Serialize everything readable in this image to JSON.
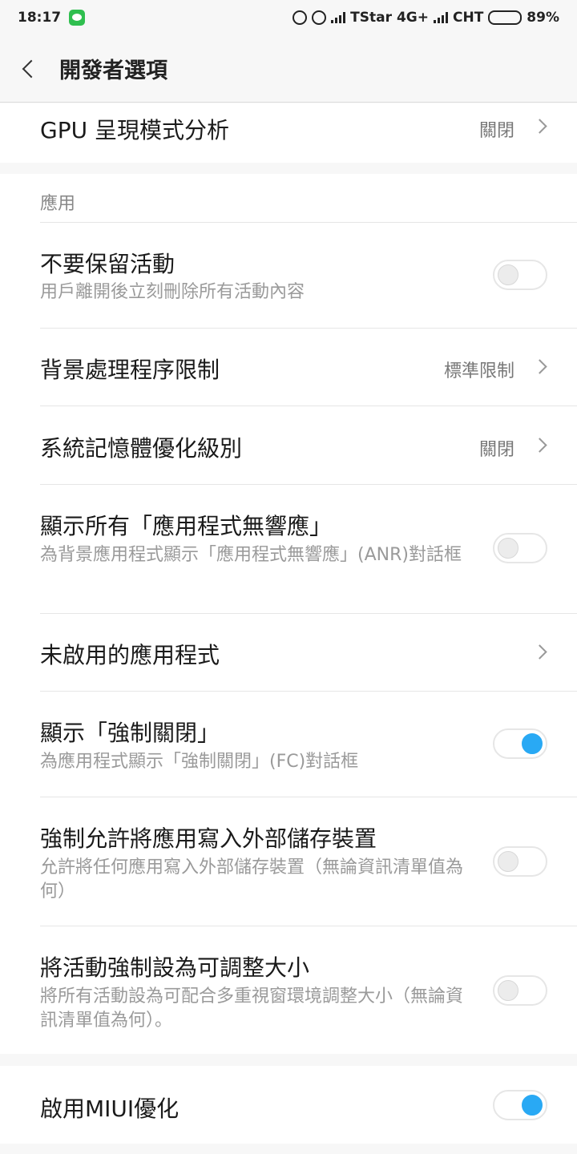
{
  "status": {
    "time": "18:17",
    "carrier1": "TStar",
    "network": "4G+",
    "carrier2": "CHT",
    "battery": "89%"
  },
  "header": {
    "title": "開發者選項"
  },
  "top_item": {
    "label": "GPU 呈現模式分析",
    "value": "關閉"
  },
  "apps_section": {
    "title": "應用",
    "items": [
      {
        "label": "不要保留活動",
        "sub": "用戶離開後立刻刪除所有活動內容",
        "toggle": false
      },
      {
        "label": "背景處理程序限制",
        "value": "標準限制"
      },
      {
        "label": "系統記憶體優化級別",
        "value": "關閉"
      },
      {
        "label": "顯示所有「應用程式無響應」",
        "sub": "為背景應用程式顯示「應用程式無響應」(ANR)對話框",
        "toggle": false
      },
      {
        "label": "未啟用的應用程式"
      },
      {
        "label": "顯示「強制關閉」",
        "sub": "為應用程式顯示「強制關閉」(FC)對話框",
        "toggle": true
      },
      {
        "label": "強制允許將應用寫入外部儲存裝置",
        "sub": "允許將任何應用寫入外部儲存裝置（無論資訊清單值為何）",
        "toggle": false
      },
      {
        "label": "將活動強制設為可調整大小",
        "sub": "將所有活動設為可配合多重視窗環境調整大小（無論資訊清單值為何）。",
        "toggle": false
      }
    ]
  },
  "miui": {
    "label": "啟用MIUI優化",
    "toggle": true
  }
}
